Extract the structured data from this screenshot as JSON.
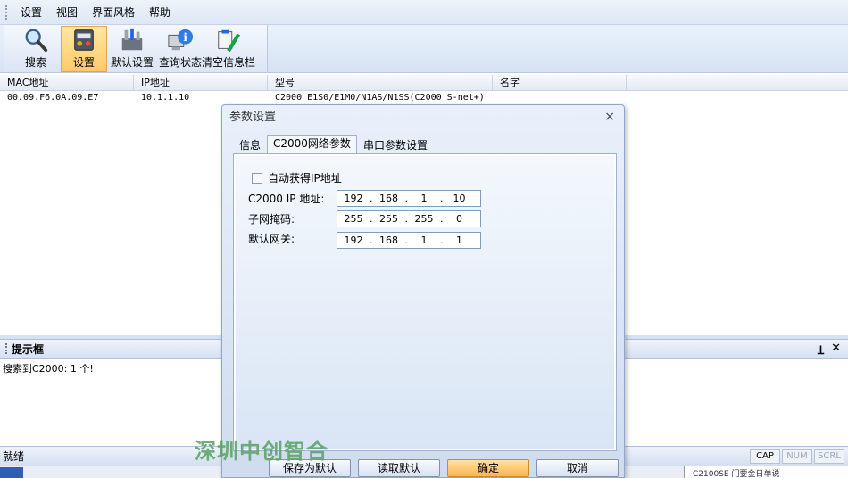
{
  "menu": [
    "设置",
    "视图",
    "界面风格",
    "帮助"
  ],
  "toolbar": [
    {
      "label": "搜索",
      "icon": "search-icon"
    },
    {
      "label": "设置",
      "icon": "settings-icon",
      "active": true
    },
    {
      "label": "默认设置",
      "icon": "default-settings-icon"
    },
    {
      "label": "查询状态",
      "icon": "query-status-icon"
    },
    {
      "label": "清空信息栏",
      "icon": "clear-info-icon"
    }
  ],
  "device_table": {
    "columns": [
      "MAC地址",
      "IP地址",
      "型号",
      "名字"
    ],
    "rows": [
      [
        "00.09.F6.0A.09.E7",
        "10.1.1.10",
        "C2000 E1S0/E1M0/N1AS/N1SS(C2000 S-net+)",
        ""
      ]
    ]
  },
  "hint_panel": {
    "title": "提示框",
    "pin_glyph": "Ʇ",
    "close_glyph": "✕",
    "message": "搜索到C2000: 1 个!"
  },
  "statusbar": {
    "text": "就绪",
    "indicators": [
      {
        "label": "CAP",
        "on": true
      },
      {
        "label": "NUM",
        "on": false
      },
      {
        "label": "SCRL",
        "on": false
      }
    ]
  },
  "bottom_right_text": "C2100SE 门要金日单说",
  "watermark": "深圳中创智合",
  "dialog": {
    "title": "参数设置",
    "close_glyph": "×",
    "tabs": [
      "信息",
      "C2000网络参数",
      "串口参数设置"
    ],
    "active_tab": 1,
    "auto_ip_label": "自动获得IP地址",
    "auto_ip_checked": false,
    "fields": [
      {
        "label": "C2000 IP 地址:",
        "octets": [
          "192",
          "168",
          "1",
          "10"
        ]
      },
      {
        "label": "子网掩码:",
        "octets": [
          "255",
          "255",
          "255",
          "0"
        ]
      },
      {
        "label": "默认网关:",
        "octets": [
          "192",
          "168",
          "1",
          "1"
        ]
      }
    ],
    "buttons": [
      "保存为默认",
      "读取默认",
      "确定",
      "取消"
    ]
  },
  "colors": {
    "accent": "#f9b54f",
    "watermark": "#5aa064",
    "chrome": "#d6e1f2"
  }
}
